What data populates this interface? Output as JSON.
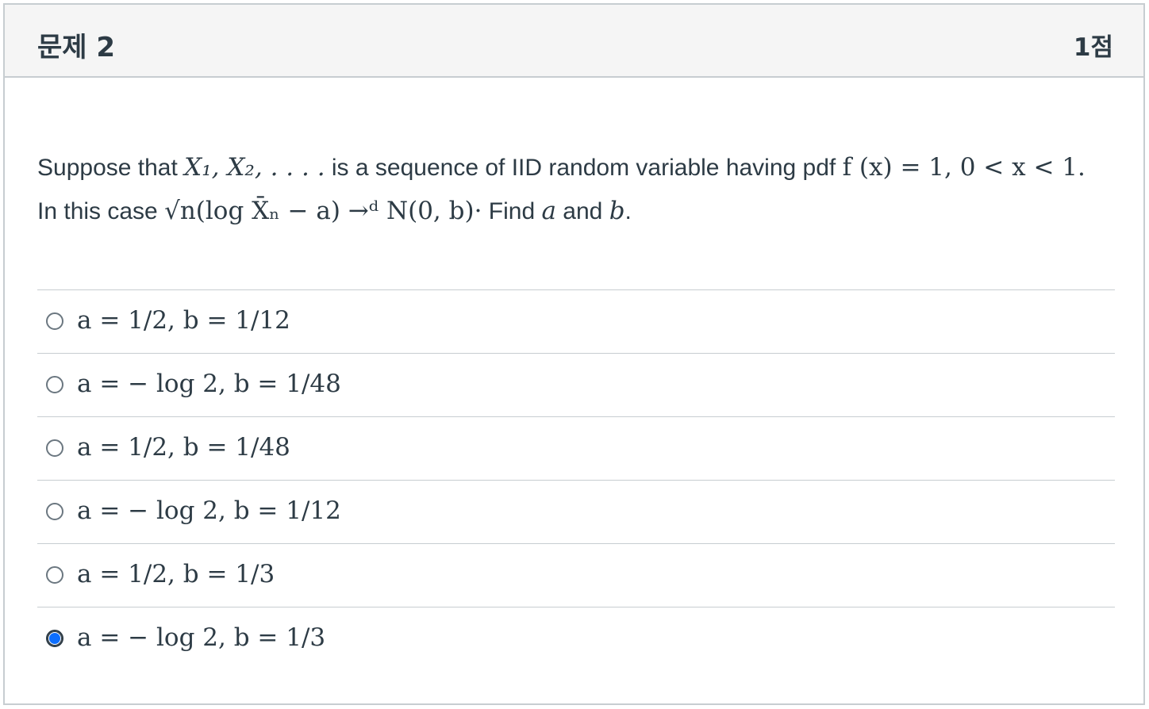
{
  "question": {
    "title": "문제 2",
    "points": "1점",
    "line1_prefix": "Suppose that ",
    "seq": "X₁, X₂, . . . .",
    "line1_mid": " is a sequence of IID random variable having pdf ",
    "pdf": "f (x) = 1,  0 < x < 1.",
    "line2_prefix": "In this case ",
    "expr": "√n(log X̄ₙ − a) →ᵈ N(0, b)·",
    "line2_mid": " Find ",
    "var_a": "a",
    "line2_and": " and ",
    "var_b": "b",
    "line2_end": "."
  },
  "answers": [
    {
      "text": "a = 1/2, b = 1/12",
      "selected": false
    },
    {
      "text": "a = − log 2, b = 1/48",
      "selected": false
    },
    {
      "text": "a = 1/2, b = 1/48",
      "selected": false
    },
    {
      "text": "a = − log 2, b = 1/12",
      "selected": false
    },
    {
      "text": "a = 1/2, b = 1/3",
      "selected": false
    },
    {
      "text": "a = − log 2, b = 1/3",
      "selected": true
    }
  ]
}
